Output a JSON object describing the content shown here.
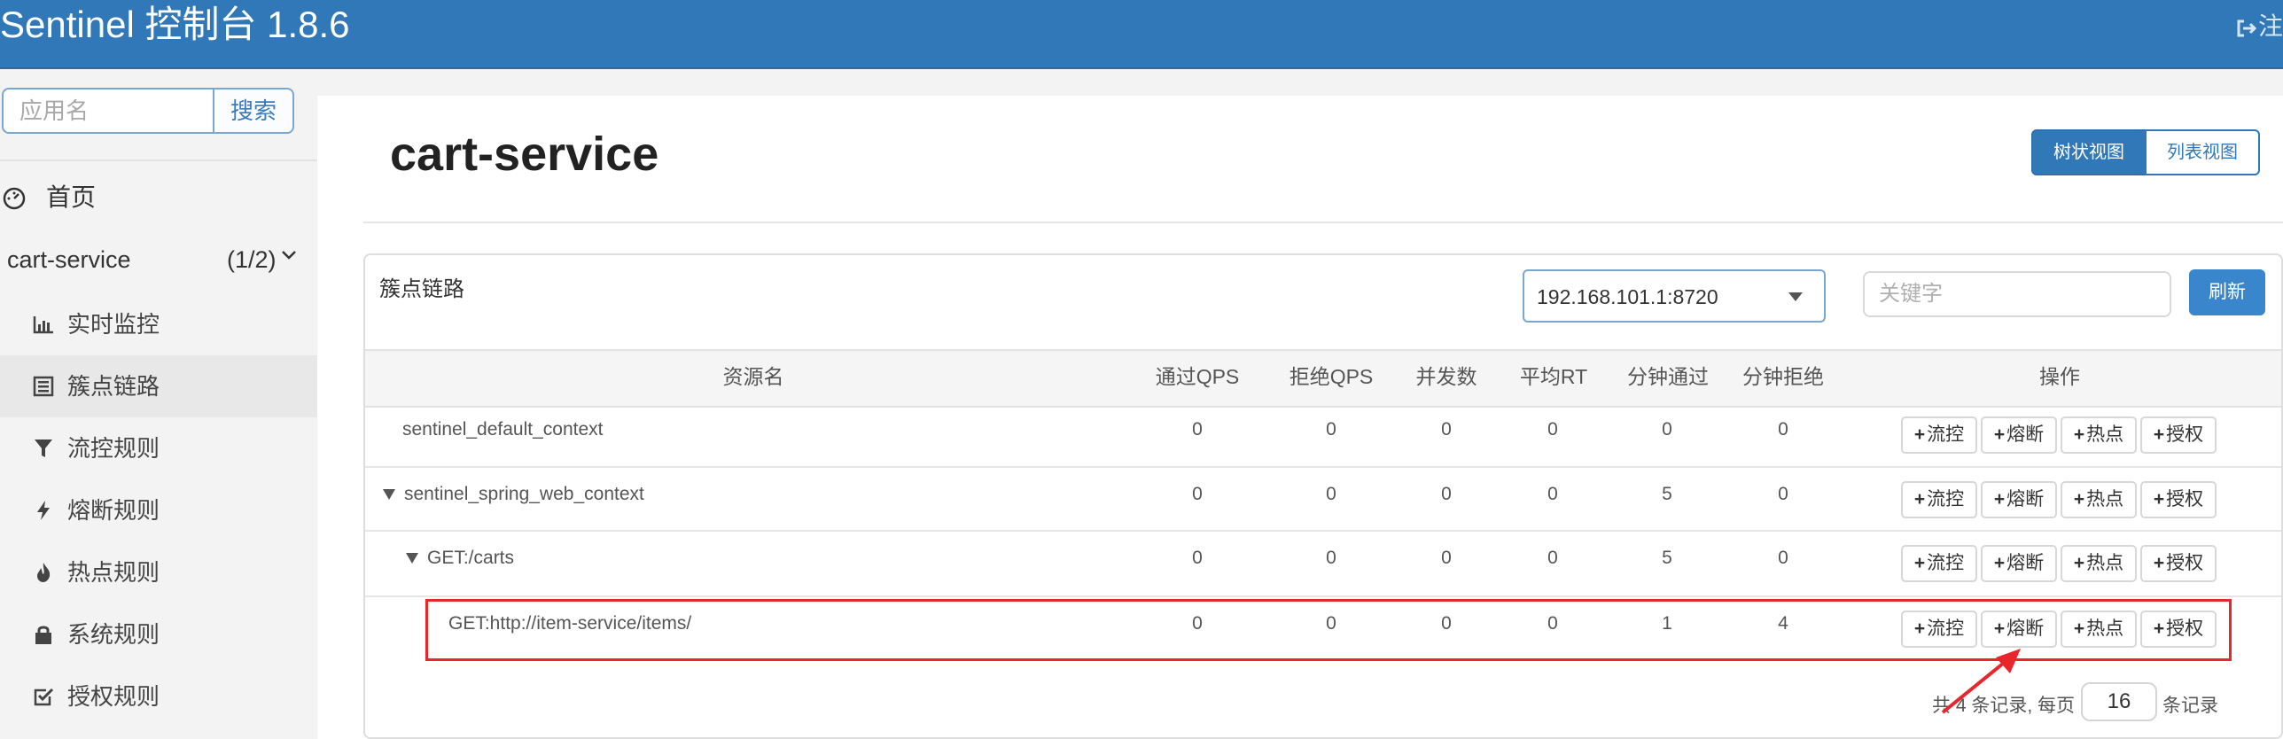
{
  "header": {
    "title": "Sentinel 控制台 1.8.6",
    "logout_label": "注"
  },
  "sidebar": {
    "search_placeholder": "应用名",
    "search_button": "搜索",
    "home_label": "首页",
    "app": {
      "name": "cart-service",
      "count": "(1/2)"
    },
    "menu": [
      {
        "label": "实时监控",
        "icon": "bar-chart-icon"
      },
      {
        "label": "簇点链路",
        "icon": "list-icon",
        "active": true
      },
      {
        "label": "流控规则",
        "icon": "filter-icon"
      },
      {
        "label": "熔断规则",
        "icon": "flash-icon"
      },
      {
        "label": "热点规则",
        "icon": "fire-icon"
      },
      {
        "label": "系统规则",
        "icon": "lock-icon"
      },
      {
        "label": "授权规则",
        "icon": "check-square-icon"
      }
    ]
  },
  "main": {
    "page_title": "cart-service",
    "view_tree": "树状视图",
    "view_list": "列表视图",
    "panel_title": "簇点链路",
    "machine": "192.168.101.1:8720",
    "keyword_placeholder": "关键字",
    "refresh": "刷新",
    "columns": [
      "资源名",
      "通过QPS",
      "拒绝QPS",
      "并发数",
      "平均RT",
      "分钟通过",
      "分钟拒绝",
      "操作"
    ],
    "ops": [
      "流控",
      "熔断",
      "热点",
      "授权"
    ],
    "rows": [
      {
        "name": "sentinel_default_context",
        "pass_qps": "0",
        "block_qps": "0",
        "concurrency": "0",
        "avg_rt": "0",
        "minute_pass": "0",
        "minute_block": "0"
      },
      {
        "name": "sentinel_spring_web_context",
        "pass_qps": "0",
        "block_qps": "0",
        "concurrency": "0",
        "avg_rt": "0",
        "minute_pass": "5",
        "minute_block": "0"
      },
      {
        "name": "GET:/carts",
        "pass_qps": "0",
        "block_qps": "0",
        "concurrency": "0",
        "avg_rt": "0",
        "minute_pass": "5",
        "minute_block": "0"
      },
      {
        "name": "GET:http://item-service/items/",
        "pass_qps": "0",
        "block_qps": "0",
        "concurrency": "0",
        "avg_rt": "0",
        "minute_pass": "1",
        "minute_block": "4"
      }
    ],
    "pager": {
      "prefix": "共 4 条记录, 每页",
      "page_size": "16",
      "suffix": "条记录"
    }
  },
  "colors": {
    "header_bg": "#3178b8",
    "primary": "#3178b8",
    "highlight": "#e8262c"
  }
}
